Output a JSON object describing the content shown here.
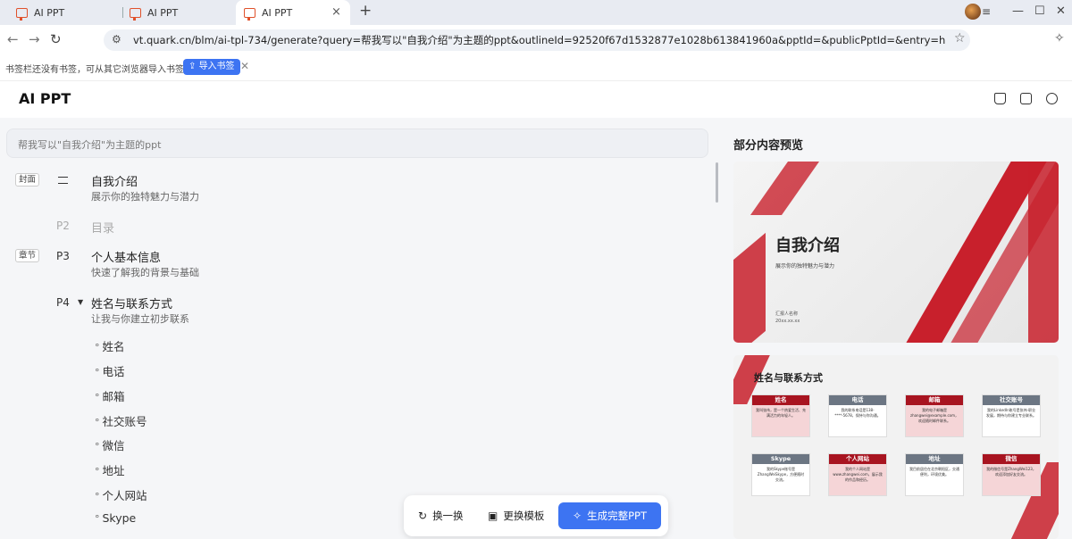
{
  "browser": {
    "tabs": [
      {
        "label": "AI PPT"
      },
      {
        "label": "AI PPT"
      },
      {
        "label": "AI PPT",
        "active": true
      }
    ],
    "new_tab": "+",
    "close_tab": "×",
    "url": "vt.quark.cn/blm/ai-tpl-734/generate?query=帮我写以\"自我介绍\"为主题的ppt&outlineId=92520f67d1532877e1028b613841960a&pptId=&publicPptId=&entry=home_search_ba...",
    "bookmarks": {
      "empty_text": "书签栏还没有书签，可从其它浏览器导入书签",
      "import_label": "导入书签"
    }
  },
  "app": {
    "logo": "AI PPT",
    "query_text": "帮我写以\"自我介绍\"为主题的ppt",
    "outline": {
      "cover_badge": "封面",
      "cover_title": "自我介绍",
      "cover_sub": "展示你的独特魅力与潜力",
      "p2_num": "P2",
      "p2_title": "目录",
      "chapter_badge": "章节",
      "p3_num": "P3",
      "p3_title": "个人基本信息",
      "p3_sub": "快速了解我的背景与基础",
      "p4_num": "P4",
      "p4_title": "姓名与联系方式",
      "p4_sub": "让我与你建立初步联系",
      "p4_items": [
        "姓名",
        "电话",
        "邮箱",
        "社交账号",
        "微信",
        "地址",
        "个人网站",
        "Skype"
      ]
    },
    "actions": {
      "swap": "换一换",
      "template": "更换模板",
      "generate": "生成完整PPT"
    },
    "preview": {
      "heading": "部分内容预览",
      "slide1": {
        "title": "自我介绍",
        "subtitle": "展示你的独特魅力与潜力",
        "author": "汇报人名称",
        "date": "20xx.xx.xx"
      },
      "slide2": {
        "title": "姓名与联系方式",
        "boxes": [
          {
            "head": "姓名",
            "body": "我叫张伟，是一个热爱生活、充满活力的年轻人。"
          },
          {
            "head": "电话",
            "body": "我的联系电话是138-****-5678，保持与你沟通。"
          },
          {
            "head": "邮箱",
            "body": "我的电子邮箱是zhangwei@example.com，欢迎随时邮件联系。"
          },
          {
            "head": "社交账号",
            "body": "我的LinkedIn账号是张伟-职业发展，期待与你建立专业联系。"
          },
          {
            "head": "Skype",
            "body": "我的Skype账号是ZhangWeiSkype，方便随时交流。"
          },
          {
            "head": "个人网站",
            "body": "我的个人网站是www.zhangwei.com，展示我的作品和经历。"
          },
          {
            "head": "地址",
            "body": "我目前居住在北京朝阳区，交通便利，环境优美。"
          },
          {
            "head": "微信",
            "body": "我的微信号是ZhangWei123，欢迎添加好友交流。"
          }
        ]
      }
    }
  }
}
